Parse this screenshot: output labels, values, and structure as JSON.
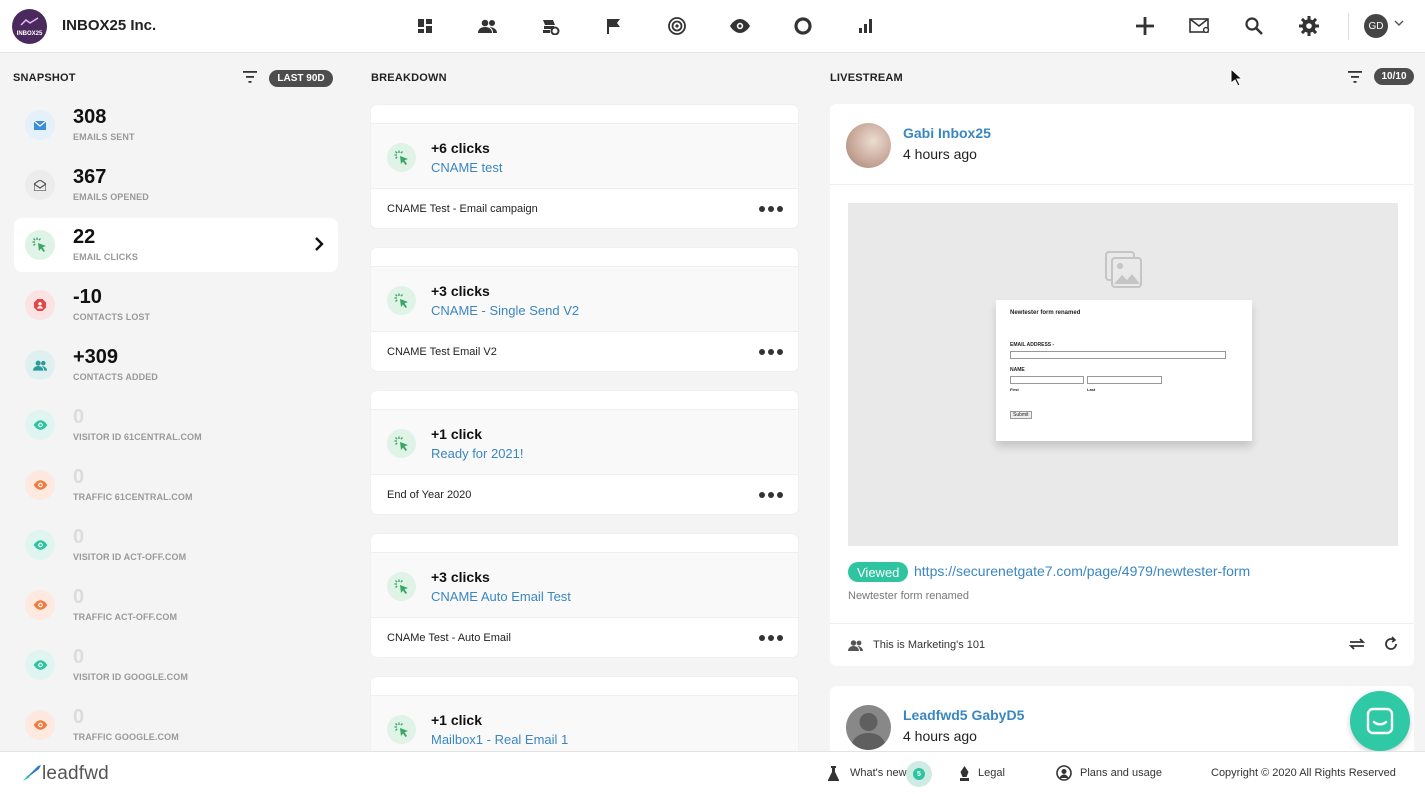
{
  "header": {
    "logo_text": "INBOX25",
    "company": "INBOX25 Inc.",
    "avatar_initials": "GD"
  },
  "snapshot": {
    "title": "SNAPSHOT",
    "range": "LAST 90D",
    "items": [
      {
        "value": "308",
        "label": "EMAILS SENT",
        "icon": "envelope-icon",
        "color": "#3b8fd6",
        "bg": "#e4f0fa"
      },
      {
        "value": "367",
        "label": "EMAILS OPENED",
        "icon": "envelope-open-icon",
        "color": "#555555",
        "bg": "#ececec"
      },
      {
        "value": "22",
        "label": "EMAIL CLICKS",
        "icon": "click-icon",
        "color": "#3aa564",
        "bg": "#dff3e7"
      },
      {
        "value": "-10",
        "label": "CONTACTS LOST",
        "icon": "contact-lost-icon",
        "color": "#e04848",
        "bg": "#fbe3e3"
      },
      {
        "value": "+309",
        "label": "CONTACTS ADDED",
        "icon": "contacts-icon",
        "color": "#2a9b9b",
        "bg": "#def0ef"
      },
      {
        "value": "0",
        "label": "VISITOR ID 61CENTRAL.COM",
        "icon": "eye-icon",
        "color": "#2ec4a0",
        "bg": "#e0f5ef"
      },
      {
        "value": "0",
        "label": "TRAFFIC 61CENTRAL.COM",
        "icon": "eye-icon",
        "color": "#f07b3f",
        "bg": "#fde9df"
      },
      {
        "value": "0",
        "label": "VISITOR ID ACT-OFF.COM",
        "icon": "eye-icon",
        "color": "#2ec4a0",
        "bg": "#e0f5ef"
      },
      {
        "value": "0",
        "label": "TRAFFIC ACT-OFF.COM",
        "icon": "eye-icon",
        "color": "#f07b3f",
        "bg": "#fde9df"
      },
      {
        "value": "0",
        "label": "VISITOR ID GOOGLE.COM",
        "icon": "eye-icon",
        "color": "#2ec4a0",
        "bg": "#e0f5ef"
      },
      {
        "value": "0",
        "label": "TRAFFIC GOOGLE.COM",
        "icon": "eye-icon",
        "color": "#f07b3f",
        "bg": "#fde9df"
      }
    ]
  },
  "breakdown": {
    "title": "BREAKDOWN",
    "cards": [
      {
        "clicks": "+6 clicks",
        "name": "CNAME test",
        "campaign": "CNAME Test - Email campaign"
      },
      {
        "clicks": "+3 clicks",
        "name": "CNAME - Single Send V2",
        "campaign": "CNAME Test Email V2"
      },
      {
        "clicks": "+1 click",
        "name": "Ready for 2021!",
        "campaign": "End of Year 2020"
      },
      {
        "clicks": "+3 clicks",
        "name": "CNAME Auto Email Test",
        "campaign": "CNAMe Test - Auto Email"
      },
      {
        "clicks": "+1 click",
        "name": "Mailbox1 - Real Email 1",
        "campaign": ""
      }
    ]
  },
  "livestream": {
    "title": "LIVESTREAM",
    "count": "10/10",
    "items": [
      {
        "name": "Gabi Inbox25",
        "time": "4 hours ago",
        "action": "Viewed",
        "url": "https://securenetgate7.com/page/4979/newtester-form",
        "subtitle": "Newtester form renamed",
        "list": "This is Marketing's 101",
        "form": {
          "title": "Newtester form renamed",
          "email_label": "EMAIL ADDRESS -",
          "name_label": "NAME",
          "first": "First",
          "last": "Last",
          "submit": "Submit"
        }
      },
      {
        "name": "Leadfwd5 GabyD5",
        "time": "4 hours ago"
      }
    ]
  },
  "footer": {
    "brand": "leadfwd",
    "whats_new": "What's new",
    "whats_new_count": "5",
    "legal": "Legal",
    "plans": "Plans and usage",
    "copyright": "Copyright © 2020 All Rights Reserved"
  }
}
